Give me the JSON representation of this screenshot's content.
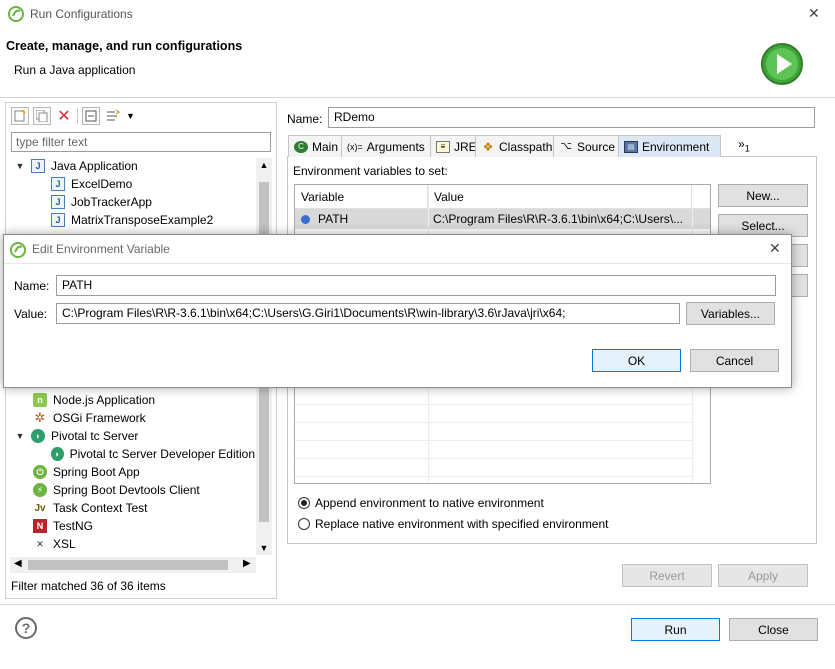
{
  "window": {
    "title": "Run Configurations"
  },
  "header": {
    "title": "Create, manage, and run configurations",
    "subtitle": "Run a Java application"
  },
  "left": {
    "filter_placeholder": "type filter text",
    "tree": [
      {
        "label": "Java Application",
        "level": 0,
        "expanded": true,
        "icon": "java-app-icon"
      },
      {
        "label": "ExcelDemo",
        "level": 1,
        "icon": "java-class-icon"
      },
      {
        "label": "JobTrackerApp",
        "level": 1,
        "icon": "java-class-icon"
      },
      {
        "label": "MatrixTransposeExample2",
        "level": 1,
        "icon": "java-class-icon"
      }
    ],
    "tree_lower": [
      {
        "label": "Node.js Application",
        "level": 0,
        "icon": "nodejs-icon"
      },
      {
        "label": "OSGi Framework",
        "level": 0,
        "icon": "osgi-icon"
      },
      {
        "label": "Pivotal tc Server",
        "level": 0,
        "expanded": true,
        "icon": "pivotal-icon"
      },
      {
        "label": "Pivotal tc Server Developer Edition",
        "level": 1,
        "icon": "pivotal-icon"
      },
      {
        "label": "Spring Boot App",
        "level": 0,
        "icon": "spring-boot-icon"
      },
      {
        "label": "Spring Boot Devtools Client",
        "level": 0,
        "icon": "spring-devtools-icon"
      },
      {
        "label": "Task Context Test",
        "level": 0,
        "icon": "task-context-icon"
      },
      {
        "label": "TestNG",
        "level": 0,
        "icon": "testng-icon"
      },
      {
        "label": "XSL",
        "level": 0,
        "icon": "xsl-icon"
      }
    ],
    "status": "Filter matched 36 of 36 items"
  },
  "right": {
    "name_label": "Name:",
    "name_value": "RDemo",
    "tabs": [
      {
        "label": "Main",
        "icon": "main-tab-icon"
      },
      {
        "label": "Arguments",
        "icon": "arguments-tab-icon",
        "icon_text": "(x)="
      },
      {
        "label": "JRE",
        "icon": "jre-tab-icon"
      },
      {
        "label": "Classpath",
        "icon": "classpath-tab-icon"
      },
      {
        "label": "Source",
        "icon": "source-tab-icon"
      },
      {
        "label": "Environment",
        "icon": "environment-tab-icon",
        "active": true
      }
    ],
    "tab_overflow": "»",
    "tab_overflow_count": "1",
    "env_label": "Environment variables to set:",
    "table": {
      "columns": [
        "Variable",
        "Value"
      ],
      "rows": [
        {
          "variable": "PATH",
          "value": "C:\\Program Files\\R\\R-3.6.1\\bin\\x64;C:\\Users\\..."
        }
      ]
    },
    "buttons": {
      "new": "New...",
      "select": "Select..."
    },
    "radio_append": "Append environment to native environment",
    "radio_replace": "Replace native environment with specified environment",
    "revert": "Revert",
    "apply": "Apply"
  },
  "footer": {
    "run": "Run",
    "close": "Close"
  },
  "dialog": {
    "title": "Edit Environment Variable",
    "name_label": "Name:",
    "name_value": "PATH",
    "value_label": "Value:",
    "value_value": "C:\\Program Files\\R\\R-3.6.1\\bin\\x64;C:\\Users\\G.Giri1\\Documents\\R\\win-library\\3.6\\rJava\\jri\\x64;",
    "variables_button": "Variables...",
    "ok": "OK",
    "cancel": "Cancel"
  },
  "colors": {
    "accent": "#0078d7",
    "selected_tab": "#dde8f5",
    "run_icon": "#3fa53a"
  }
}
